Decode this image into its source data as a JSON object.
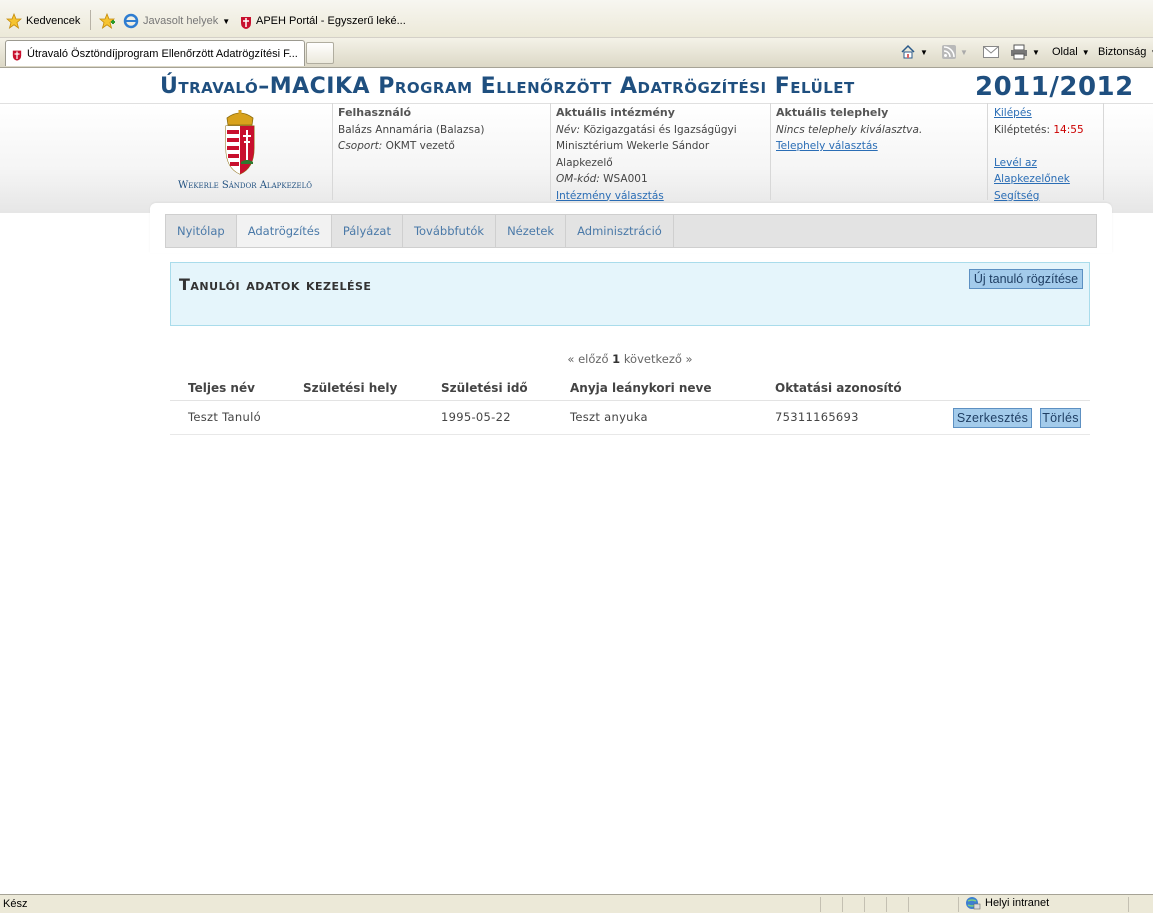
{
  "browser": {
    "favorites_label": "Kedvencek",
    "suggested_label": "Javasolt helyek",
    "apeh_label": "APEH Portál - Egyszerű leké...",
    "tab_title": "Útravaló Ösztöndíjprogram Ellenőrzött Adatrögzítési F...",
    "page_menu": "Oldal",
    "safety_menu": "Biztonság",
    "status_text": "Kész",
    "zone_text": "Helyi intranet"
  },
  "header": {
    "title": "Útravaló–MACIKA Program Ellenőrzött Adatrögzítési Felület",
    "year": "2011/2012",
    "logo_text": "Wekerle Sándor Alapkezelő",
    "user": {
      "heading": "Felhasználó",
      "name": "Balázs Annamária (Balazsa)",
      "group_label": "Csoport:",
      "group_value": "OKMT vezető"
    },
    "institution": {
      "heading": "Aktuális intézmény",
      "name_label": "Név:",
      "name_value": "Közigazgatási és Igazságügyi",
      "name_line2": "Minisztérium Wekerle Sándor",
      "name_line3": "Alapkezelő",
      "om_label": "OM-kód:",
      "om_value": "WSA001",
      "choose_link": "Intézmény választás"
    },
    "site": {
      "heading": "Aktuális telephely",
      "none_text": "Nincs telephely kiválasztva.",
      "choose_link": "Telephely választás"
    },
    "session": {
      "logout_link": "Kilépés",
      "logout_time_label": "Kiléptetés:",
      "logout_time_value": "14:55",
      "letter_link_1": "Levél az",
      "letter_link_2": "Alapkezelőnek",
      "help_link": "Segítség"
    }
  },
  "nav": {
    "items": [
      "Nyitólap",
      "Adatrögzítés",
      "Pályázat",
      "Továbbfutók",
      "Nézetek",
      "Adminisztráció"
    ]
  },
  "content": {
    "panel_title": "Tanulói adatok kezelése",
    "new_student_button": "Új tanuló rögzítése",
    "pager": {
      "prev": "« előző",
      "current": "1",
      "next": "következő »"
    },
    "table": {
      "headers": [
        "Teljes név",
        "Születési hely",
        "Születési idő",
        "Anyja leánykori neve",
        "Oktatási azonosító"
      ],
      "rows": [
        {
          "full_name": "Teszt Tanuló",
          "birth_place": "",
          "birth_date": "1995-05-22",
          "mother_name": "Teszt anyuka",
          "edu_id": "75311165693",
          "edit_label": "Szerkesztés",
          "delete_label": "Törlés"
        }
      ]
    }
  }
}
